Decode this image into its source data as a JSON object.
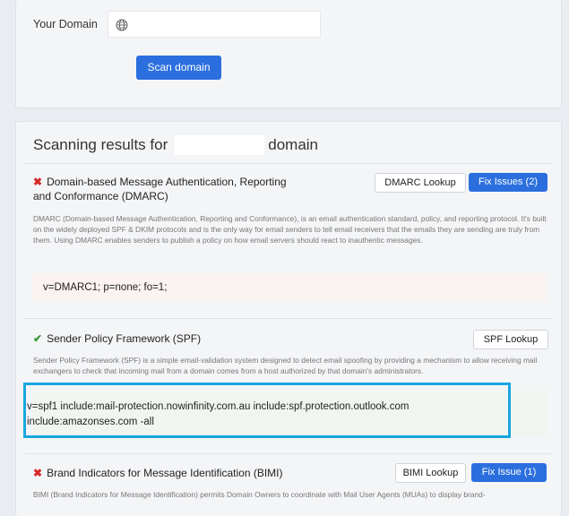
{
  "scan_form": {
    "domain_label": "Your Domain",
    "domain_value": "",
    "scan_button": "Scan domain"
  },
  "results": {
    "title_prefix": "Scanning results for",
    "title_suffix": "domain",
    "sections": [
      {
        "status": "fail",
        "title_line1": "Domain-based Message Authentication, Reporting",
        "title_line2": "and Conformance (DMARC)",
        "lookup_button": "DMARC Lookup",
        "fix_button": "Fix Issues (2)",
        "description": "DMARC (Domain-based Message Authentication, Reporting and Conformance), is an email authentication standard, policy, and reporting protocol. It's built on the widely deployed SPF & DKIM protocols and is the only way for email senders to tell email receivers that the emails they are sending are truly from them. Using DMARC enables senders to publish a policy on how email servers should react to inauthentic messages.",
        "record": "v=DMARC1; p=none; fo=1;"
      },
      {
        "status": "pass",
        "title_line1": "Sender Policy Framework (SPF)",
        "lookup_button": "SPF Lookup",
        "description": "Sender Policy Framework (SPF) is a simple email-validation system designed to detect email spoofing by providing a mechanism to allow receiving mail exchangers to check that incoming mail from a domain comes from a host authorized by that domain's administrators.",
        "record_line1": "v=spf1 include:mail-protection.nowinfinity.com.au include:spf.protection.outlook.com",
        "record_line2": "include:amazonses.com -all"
      },
      {
        "status": "fail",
        "title_line1": "Brand Indicators for Message Identification (BIMI)",
        "lookup_button": "BIMI Lookup",
        "fix_button": "Fix Issue (1)",
        "description": "BIMI (Brand Indicators for Message Identification) permits Domain Owners to coordinate with Mail User Agents (MUAs) to display brand-"
      }
    ]
  },
  "colors": {
    "primary": "#2b6fde",
    "fail": "#d62828",
    "pass": "#3a9c3a",
    "highlight": "#19a6e0"
  },
  "icons": {
    "fail": "x-mark-icon",
    "pass": "checkmark-icon",
    "domain_input": "globe-icon"
  }
}
